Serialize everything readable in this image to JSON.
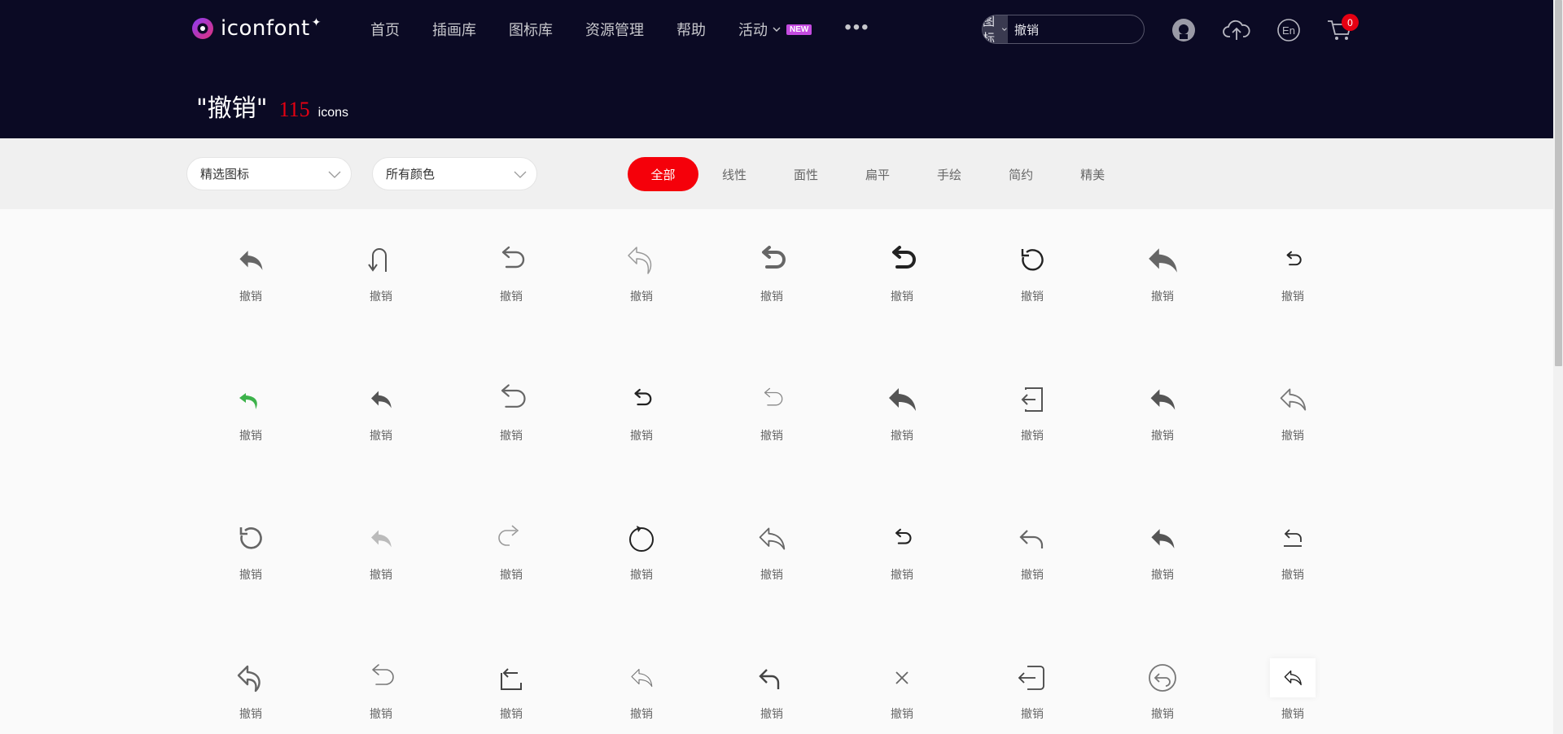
{
  "brand": {
    "name": "iconfont",
    "plus": "✦"
  },
  "nav": {
    "items": [
      {
        "label": "首页",
        "has_caret": false
      },
      {
        "label": "插画库",
        "has_caret": false
      },
      {
        "label": "图标库",
        "has_caret": false
      },
      {
        "label": "资源管理",
        "has_caret": false
      },
      {
        "label": "帮助",
        "has_caret": false
      },
      {
        "label": "活动",
        "has_caret": true,
        "badge": "NEW"
      }
    ],
    "more": "•••"
  },
  "search": {
    "type_label": "图标",
    "value": "撤销"
  },
  "cart": {
    "count": "0"
  },
  "header_icons": [
    "github-icon",
    "upload-cloud-icon",
    "language-en-icon",
    "cart-icon"
  ],
  "language_label": "En",
  "result": {
    "keyword": "\"撤销\"",
    "count": "115",
    "unit": "icons"
  },
  "filters": {
    "dropdown1": "精选图标",
    "dropdown2": "所有颜色",
    "tabs": [
      "全部",
      "线性",
      "面性",
      "扁平",
      "手绘",
      "简约",
      "精美"
    ],
    "active_tab": "全部"
  },
  "colors": {
    "accent": "#f5000a",
    "header_bg": "#0b0a24",
    "new_badge": "#c44be0",
    "green_icon": "#3cb24a"
  },
  "icons": [
    {
      "name": "undo-filled-arrow-icon",
      "label": "撤销"
    },
    {
      "name": "u-turn-arrow-icon",
      "label": "撤销"
    },
    {
      "name": "undo-arrow-icon",
      "label": "撤销"
    },
    {
      "name": "undo-outline-arrow-icon",
      "label": "撤销"
    },
    {
      "name": "undo-bold-arrow-icon",
      "label": "撤销"
    },
    {
      "name": "undo-heavy-arrow-icon",
      "label": "撤销"
    },
    {
      "name": "rotate-ccw-icon",
      "label": "撤销"
    },
    {
      "name": "reply-large-icon",
      "label": "撤销"
    },
    {
      "name": "undo-small-icon",
      "label": "撤销"
    },
    {
      "name": "reply-green-icon",
      "label": "撤销"
    },
    {
      "name": "reply-small-filled-icon",
      "label": "撤销"
    },
    {
      "name": "undo-wide-icon",
      "label": "撤销"
    },
    {
      "name": "undo-thick-small-icon",
      "label": "撤销"
    },
    {
      "name": "undo-thin-icon",
      "label": "撤销"
    },
    {
      "name": "reply-big-filled-icon",
      "label": "撤销"
    },
    {
      "name": "exit-box-icon",
      "label": "撤销"
    },
    {
      "name": "reply-filled-icon",
      "label": "撤销"
    },
    {
      "name": "reply-outline-icon",
      "label": "撤销"
    },
    {
      "name": "rotate-ccw-gray-icon",
      "label": "撤销"
    },
    {
      "name": "reply-light-icon",
      "label": "撤销"
    },
    {
      "name": "redo-arrow-icon",
      "label": "撤销"
    },
    {
      "name": "refresh-circle-icon",
      "label": "撤销"
    },
    {
      "name": "reply-outline-gray-icon",
      "label": "撤销"
    },
    {
      "name": "undo-dark-small-icon",
      "label": "撤销"
    },
    {
      "name": "reply-line-icon",
      "label": "撤销"
    },
    {
      "name": "reply-filled-gray-icon",
      "label": "撤销"
    },
    {
      "name": "undo-underline-icon",
      "label": "撤销"
    },
    {
      "name": "reply-curved-outline-icon",
      "label": "撤销"
    },
    {
      "name": "undo-thin-outline-icon",
      "label": "撤销"
    },
    {
      "name": "undo-corner-box-icon",
      "label": "撤销"
    },
    {
      "name": "reply-sketch-icon",
      "label": "撤销"
    },
    {
      "name": "return-arrow-icon",
      "label": "撤销"
    },
    {
      "name": "close-x-icon",
      "label": "撤销"
    },
    {
      "name": "sign-out-box-icon",
      "label": "撤销"
    },
    {
      "name": "undo-circle-icon",
      "label": "撤销"
    },
    {
      "name": "reply-small-outline-icon",
      "label": "撤销"
    }
  ]
}
